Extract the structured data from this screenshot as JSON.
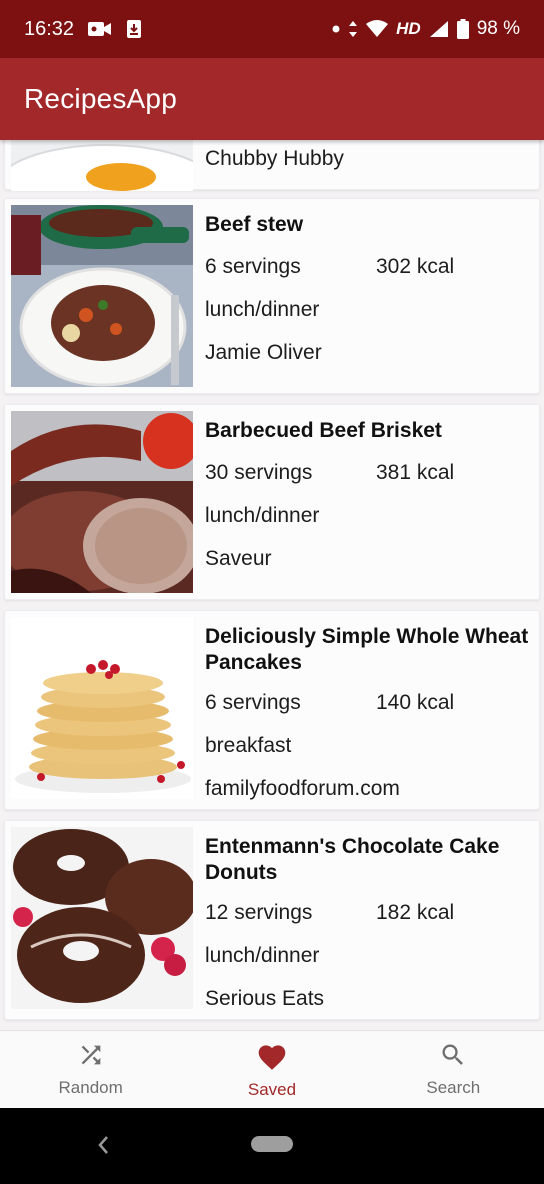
{
  "status_bar": {
    "time": "16:32",
    "battery": "98 %",
    "network": "HD"
  },
  "app_bar": {
    "title": "RecipesApp"
  },
  "colors": {
    "status_bar": "#7d1010",
    "app_bar": "#a2282a",
    "accent": "#a2282a"
  },
  "partial_card": {
    "source": "Chubby Hubby"
  },
  "recipes": [
    {
      "title": "Beef stew",
      "servings": "6 servings",
      "kcal": "302 kcal",
      "meal": "lunch/dinner",
      "source": "Jamie Oliver",
      "image": "beef-stew-image"
    },
    {
      "title": "Barbecued Beef Brisket",
      "servings": "30 servings",
      "kcal": "381 kcal",
      "meal": "lunch/dinner",
      "source": "Saveur",
      "image": "beef-brisket-image"
    },
    {
      "title": "Deliciously Simple Whole Wheat Pancakes",
      "servings": "6 servings",
      "kcal": "140 kcal",
      "meal": "breakfast",
      "source": "familyfoodforum.com",
      "image": "pancakes-image"
    },
    {
      "title": "Entenmann's Chocolate Cake Donuts",
      "servings": "12 servings",
      "kcal": "182 kcal",
      "meal": "lunch/dinner",
      "source": "Serious Eats",
      "image": "donuts-image"
    }
  ],
  "bottom_nav": [
    {
      "label": "Random",
      "icon": "shuffle-icon"
    },
    {
      "label": "Saved",
      "icon": "heart-icon",
      "active": true
    },
    {
      "label": "Search",
      "icon": "search-icon"
    }
  ]
}
